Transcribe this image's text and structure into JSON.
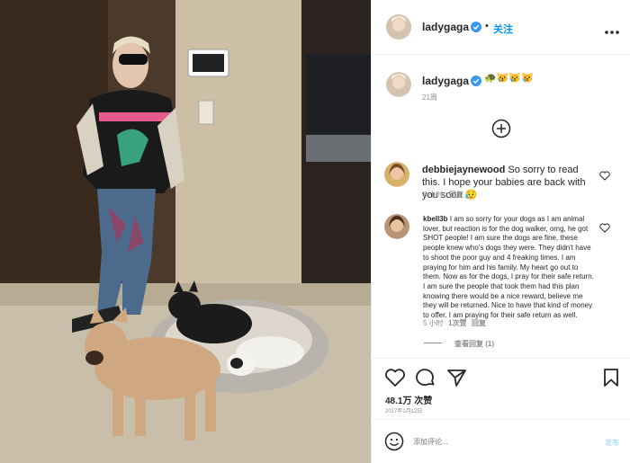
{
  "header": {
    "username": "ladygaga",
    "separator": "•",
    "follow_label": "关注",
    "more_icon": "more-horizontal-icon"
  },
  "caption": {
    "username": "ladygaga",
    "text": "🐢😿😿😿",
    "time": "21周"
  },
  "load_more_icon": "plus-circle-icon",
  "comments": [
    {
      "username": "debbiejaynewood",
      "text": "So sorry to read this. I hope your babies are back with you soon 😥",
      "time": "5 小时",
      "reply_label": "回复"
    },
    {
      "username": "kbell3b",
      "text": "I am so sorry for your dogs as I am animal lover, but reaction is for the dog walker, omg, he got SHOT people! I am sure the dogs are fine, these people knew who's dogs they were. They didn't have to shoot the poor guy and 4 freaking times. I am praying for him and his family. My heart go out to them. Now as for the dogs, I pray for their safe return. I am sure the people that took them had this plan knowing there would be a nice reward, believe me they will be returned. Nice to have that kind of money to offer. I am praying for their safe return as well.",
      "time": "5 小时",
      "likes": "1次赞",
      "reply_label": "回复",
      "view_replies": "查看回复 (1)"
    }
  ],
  "actions": {
    "like_icon": "heart-icon",
    "comment_icon": "comment-icon",
    "share_icon": "paper-plane-icon",
    "save_icon": "bookmark-icon"
  },
  "likes": "48.1万 次赞",
  "date": "2017年1月12日",
  "add_comment": {
    "placeholder": "添加评论...",
    "post_label": "发布",
    "emoji_icon": "smiley-icon"
  },
  "colors": {
    "accent": "#0095f6",
    "verified": "#3897f0",
    "post_disabled": "#b2dffc",
    "divider": "#efefef"
  }
}
